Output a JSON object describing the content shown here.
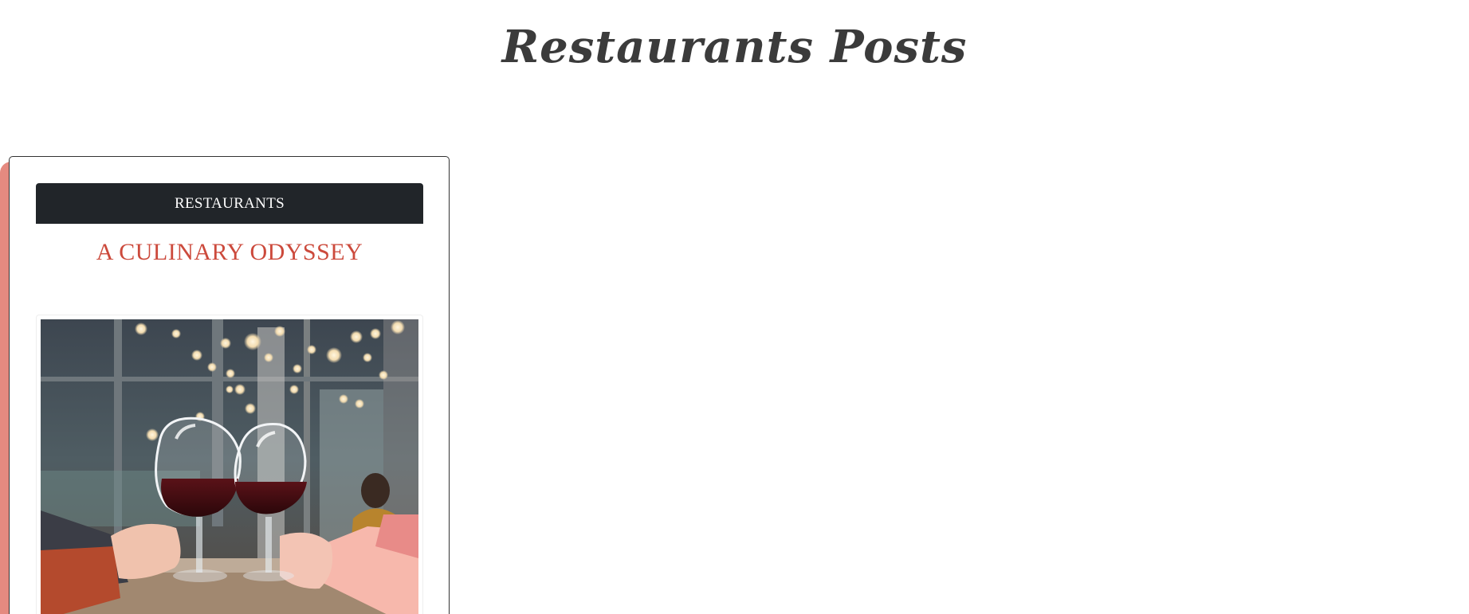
{
  "page": {
    "title": "Restaurants Posts"
  },
  "post": {
    "category": "RESTAURANTS",
    "title": "A CULINARY ODYSSEY"
  },
  "colors": {
    "title_text": "#3b3b3b",
    "badge_background": "#212529",
    "badge_text": "#ffffff",
    "post_title_text": "#cc4a3c",
    "card_border": "#333333",
    "card_accent": "#e58a80"
  },
  "image": {
    "subject": "two glasses of red wine clinking in a restaurant"
  }
}
